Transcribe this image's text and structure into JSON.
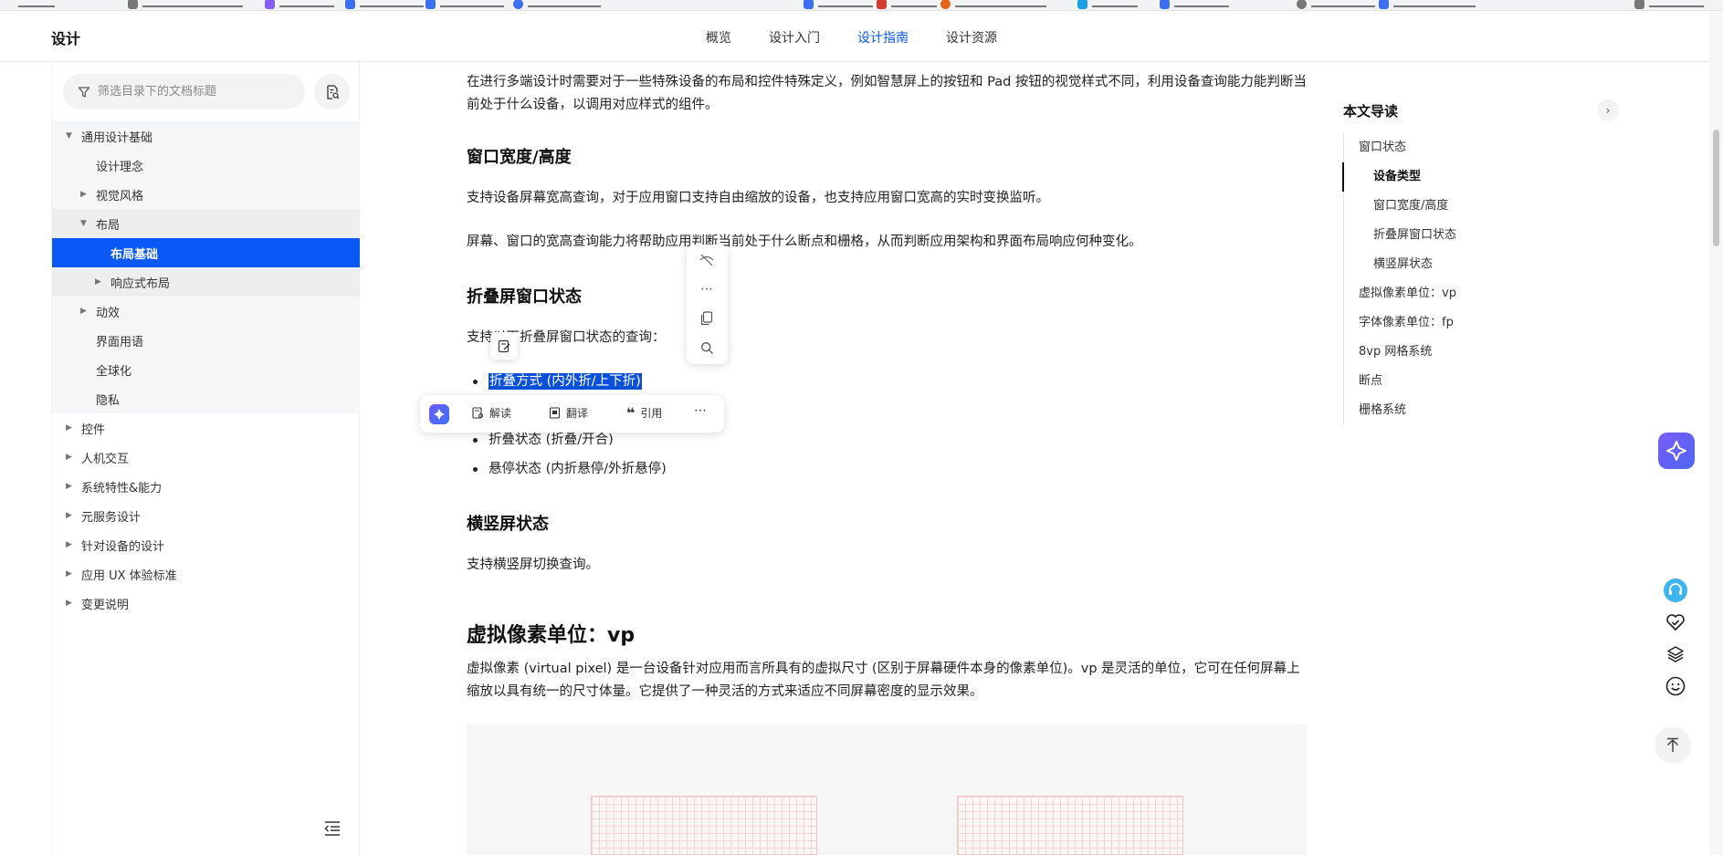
{
  "app": {
    "brand": "设计"
  },
  "nav": {
    "tabs": [
      {
        "label": "概览"
      },
      {
        "label": "设计入门"
      },
      {
        "label": "设计指南"
      },
      {
        "label": "设计资源"
      }
    ]
  },
  "sidebar": {
    "filter_placeholder": "筛选目录下的文档标题",
    "tree": [
      {
        "label": "通用设计基础"
      },
      {
        "label": "设计理念"
      },
      {
        "label": "视觉风格"
      },
      {
        "label": "布局"
      },
      {
        "label": "布局基础"
      },
      {
        "label": "响应式布局"
      },
      {
        "label": "动效"
      },
      {
        "label": "界面用语"
      },
      {
        "label": "全球化"
      },
      {
        "label": "隐私"
      },
      {
        "label": "控件"
      },
      {
        "label": "人机交互"
      },
      {
        "label": "系统特性&能力"
      },
      {
        "label": "元服务设计"
      },
      {
        "label": "针对设备的设计"
      },
      {
        "label": "应用 UX 体验标准"
      },
      {
        "label": "变更说明"
      }
    ]
  },
  "content": {
    "intro": "在进行多端设计时需要对于一些特殊设备的布局和控件特殊定义，例如智慧屏上的按钮和 Pad 按钮的视觉样式不同，利用设备查询能力能判断当前处于什么设备，以调用对应样式的组件。",
    "h_window": "窗口宽度/高度",
    "p_window_1": "支持设备屏幕宽高查询，对于应用窗口支持自由缩放的设备，也支持应用窗口宽高的实时变换监听。",
    "p_window_2": "屏幕、窗口的宽高查询能力将帮助应用判断当前处于什么断点和栅格，从而判断应用架构和界面布局响应何种变化。",
    "h_fold": "折叠屏窗口状态",
    "p_fold": "支持以下折叠屏窗口状态的查询：",
    "fold_items": [
      "折叠方式 (内外折/上下折)",
      "折叠状态 (折叠/开合)",
      "悬停状态 (内折悬停/外折悬停)"
    ],
    "h_orient": "横竖屏状态",
    "p_orient": "支持横竖屏切换查询。",
    "h_vp": "虚拟像素单位：vp",
    "p_vp": "虚拟像素 (virtual pixel) 是一台设备针对应用而言所具有的虚拟尺寸 (区别于屏幕硬件本身的像素单位)。vp 是灵活的单位，它可在任何屏幕上缩放以具有统一的尺寸体量。它提供了一种灵活的方式来适应不同屏幕密度的显示效果。"
  },
  "selection_toolbar": {
    "actions": [
      {
        "label": "解读"
      },
      {
        "label": "翻译"
      },
      {
        "label": "引用"
      }
    ]
  },
  "toc": {
    "title": "本文导读",
    "items": [
      {
        "label": "窗口状态"
      },
      {
        "label": "设备类型"
      },
      {
        "label": "窗口宽度/高度"
      },
      {
        "label": "折叠屏窗口状态"
      },
      {
        "label": "横竖屏状态"
      },
      {
        "label": "虚拟像素单位：vp"
      },
      {
        "label": "字体像素单位：fp"
      },
      {
        "label": "8vp 网格系统"
      },
      {
        "label": "断点"
      },
      {
        "label": "栅格系统"
      }
    ]
  },
  "colors": {
    "accent": "#0a59f7",
    "selection": "#0a50d8",
    "ai": "#6d5cf6"
  }
}
